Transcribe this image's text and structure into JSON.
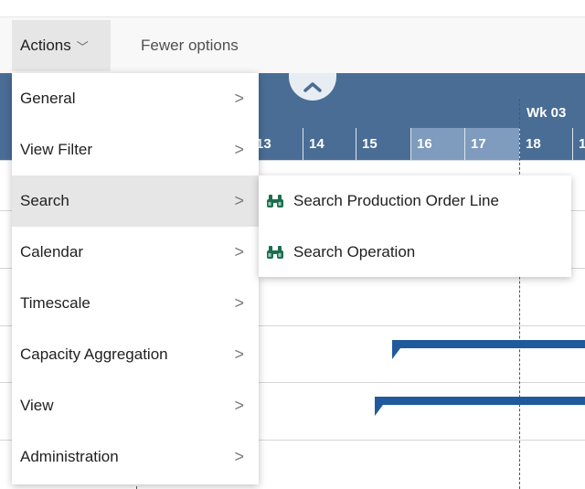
{
  "actionbar": {
    "actions_label": "Actions",
    "actions_chevron": "﹀",
    "fewer_options_label": "Fewer options"
  },
  "gantt": {
    "week_label": "Wk 03",
    "days": [
      "13",
      "14",
      "15",
      "16",
      "17",
      "18",
      "1"
    ],
    "header_color": "#4a6d95",
    "bar_color": "#1f5b9c"
  },
  "menu": {
    "items": [
      {
        "label": "General",
        "arrow": ">"
      },
      {
        "label": "View Filter",
        "arrow": ">"
      },
      {
        "label": "Search",
        "arrow": ">"
      },
      {
        "label": "Calendar",
        "arrow": ">"
      },
      {
        "label": "Timescale",
        "arrow": ">"
      },
      {
        "label": "Capacity Aggregation",
        "arrow": ">"
      },
      {
        "label": "View",
        "arrow": ">"
      },
      {
        "label": "Administration",
        "arrow": ">"
      }
    ],
    "active_item": "Search"
  },
  "submenu": {
    "items": [
      {
        "label": "Search Production Order Line",
        "icon": "binoculars-icon"
      },
      {
        "label": "Search Operation",
        "icon": "binoculars-icon"
      }
    ]
  }
}
